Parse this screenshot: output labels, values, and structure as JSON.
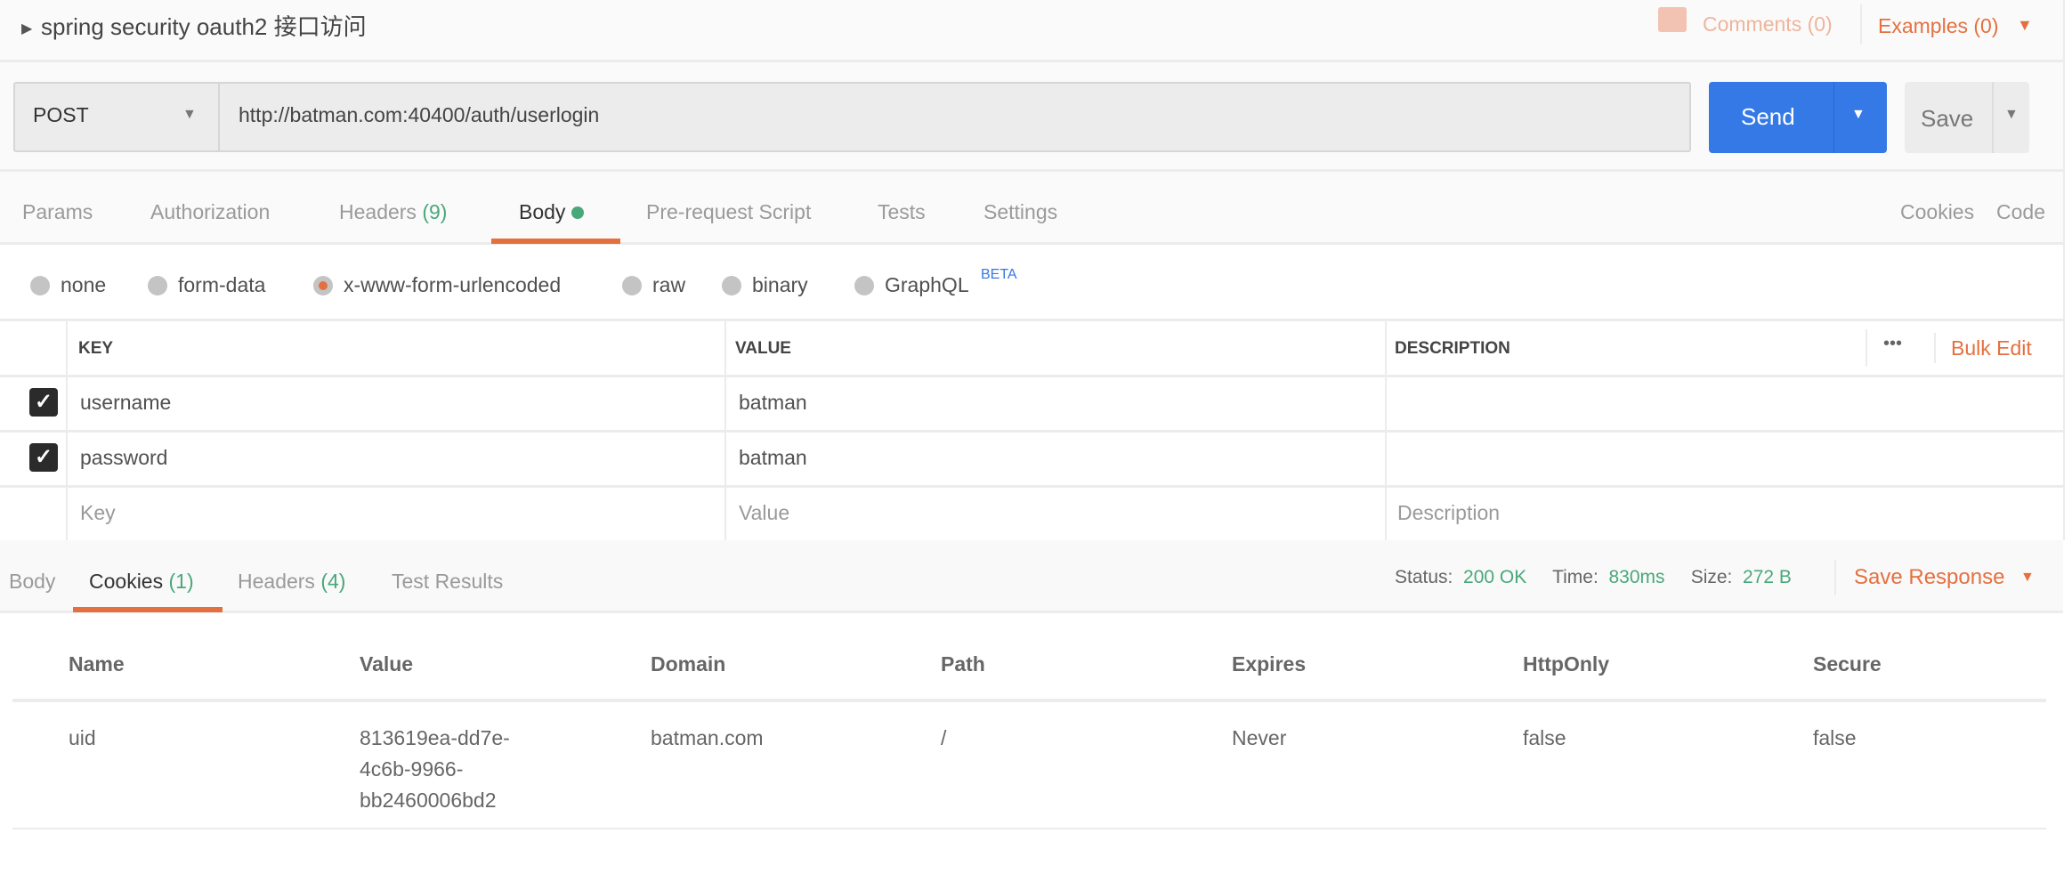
{
  "title": {
    "expand_icon": "caret-right-icon",
    "text": "spring security oauth2 接口访问",
    "comments": "Comments (0)",
    "examples": "Examples (0)"
  },
  "request": {
    "method": "POST",
    "url": "http://batman.com:40400/auth/userlogin",
    "send": "Send",
    "save": "Save"
  },
  "req_tabs": [
    {
      "label": "Params"
    },
    {
      "label": "Authorization"
    },
    {
      "label": "Headers",
      "count": "(9)"
    },
    {
      "label": "Body",
      "active": true
    },
    {
      "label": "Pre-request Script"
    },
    {
      "label": "Tests"
    },
    {
      "label": "Settings"
    }
  ],
  "req_links": {
    "cookies": "Cookies",
    "code": "Code"
  },
  "body_types": [
    {
      "label": "none"
    },
    {
      "label": "form-data"
    },
    {
      "label": "x-www-form-urlencoded",
      "selected": true
    },
    {
      "label": "raw"
    },
    {
      "label": "binary"
    },
    {
      "label": "GraphQL",
      "badge": "BETA"
    }
  ],
  "params_table": {
    "headers": {
      "key": "KEY",
      "value": "VALUE",
      "description": "DESCRIPTION",
      "more": "•••",
      "bulk_edit": "Bulk Edit"
    },
    "rows": [
      {
        "checked": true,
        "key": "username",
        "value": "batman",
        "description": ""
      },
      {
        "checked": true,
        "key": "password",
        "value": "batman",
        "description": ""
      }
    ],
    "placeholders": {
      "key": "Key",
      "value": "Value",
      "description": "Description"
    }
  },
  "res_tabs": [
    {
      "label": "Body"
    },
    {
      "label": "Cookies",
      "count": "(1)",
      "active": true
    },
    {
      "label": "Headers",
      "count": "(4)"
    },
    {
      "label": "Test Results"
    }
  ],
  "status": {
    "status_label": "Status:",
    "status": "200 OK",
    "time_label": "Time:",
    "time": "830ms",
    "size_label": "Size:",
    "size": "272 B",
    "save_response": "Save Response"
  },
  "cookies": {
    "headers": [
      "Name",
      "Value",
      "Domain",
      "Path",
      "Expires",
      "HttpOnly",
      "Secure"
    ],
    "rows": [
      {
        "name": "uid",
        "value_lines": [
          "813619ea-dd7e-",
          "4c6b-9966-",
          "bb2460006bd2"
        ],
        "domain": "batman.com",
        "path": "/",
        "expires": "Never",
        "httponly": "false",
        "secure": "false"
      }
    ]
  },
  "colors": {
    "accent": "#e5703f",
    "send": "#3479e6",
    "green": "#49a87a"
  }
}
